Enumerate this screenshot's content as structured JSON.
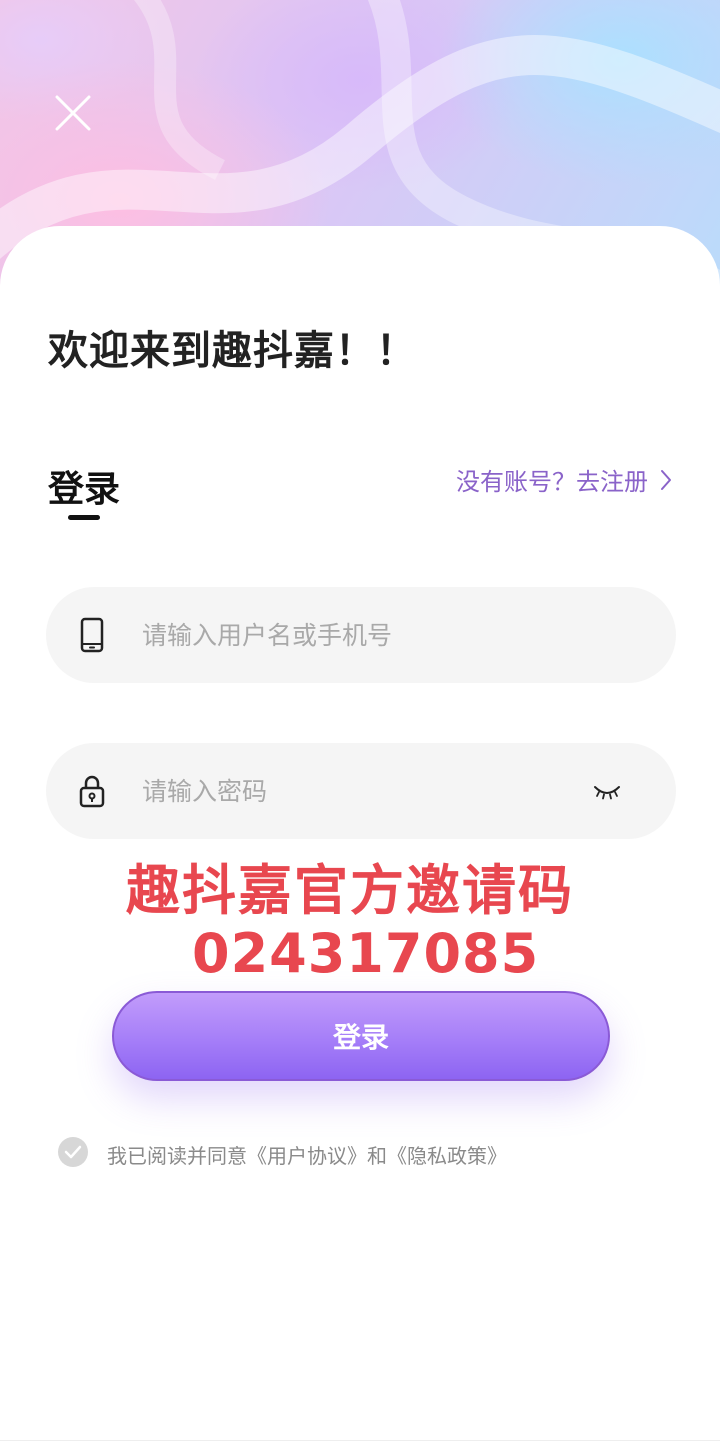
{
  "header": {
    "close_icon": "close-icon"
  },
  "welcome_title": "欢迎来到趣抖嘉！！",
  "tabs": {
    "login_label": "登录"
  },
  "register_link": {
    "label": "没有账号？去注册",
    "icon": "chevron-right-icon"
  },
  "form": {
    "username": {
      "placeholder": "请输入用户名或手机号",
      "value": "",
      "icon": "phone-icon"
    },
    "password": {
      "placeholder": "请输入密码",
      "value": "",
      "icon": "lock-icon",
      "toggle_icon": "eye-closed-icon"
    }
  },
  "promo": {
    "line1": "趣抖嘉官方邀请码",
    "line2": "024317085"
  },
  "login_button": {
    "label": "登录"
  },
  "agreement": {
    "prefix": "我已阅读并同意",
    "user_agreement": "《用户协议》",
    "conjunction": "和",
    "privacy_policy": "《隐私政策》",
    "checked": true
  },
  "colors": {
    "accent": "#8a63c9",
    "button": "#a57ef8",
    "promo": "#e8474f"
  }
}
